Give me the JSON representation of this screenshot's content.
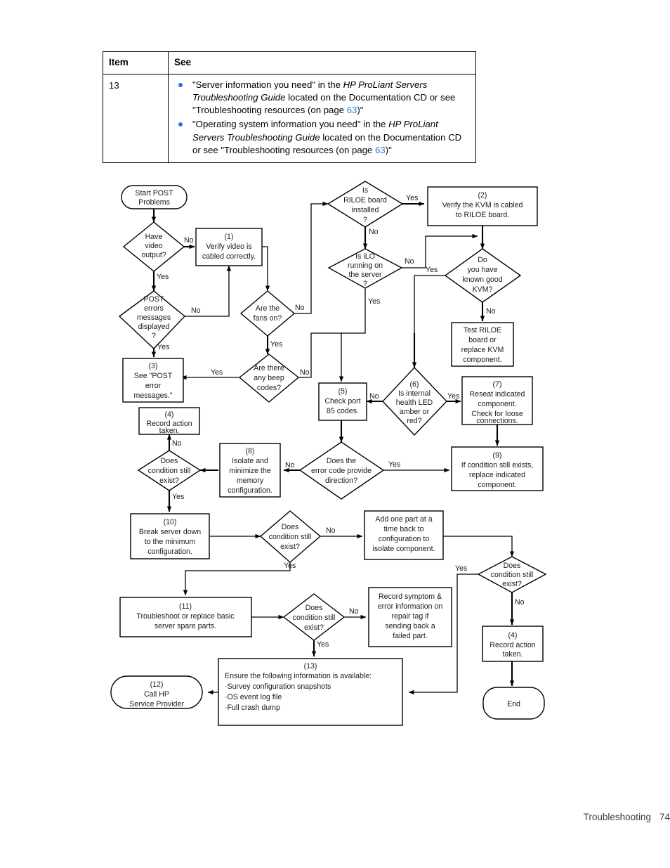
{
  "table": {
    "headers": [
      "Item",
      "See"
    ],
    "rows": [
      {
        "item": "13",
        "bullets": [
          {
            "pre": "\"Server information you need\" in the ",
            "italic": "HP ProLiant Servers Troubleshooting Guide",
            "mid": " located on the Documentation CD or see \"Troubleshooting resources (on page ",
            "link": "63",
            "post": ")\""
          },
          {
            "pre": "\"Operating system information you need\" in the ",
            "italic": "HP ProLiant Servers Troubleshooting Guide",
            "mid": " located on the Documentation CD or see \"Troubleshooting resources (on page ",
            "link": "63",
            "post": ")\""
          }
        ]
      }
    ]
  },
  "flowchart": {
    "title": "POST problems troubleshooting flowchart",
    "nodes": {
      "start": {
        "shape": "terminator",
        "lines": [
          "Start POST",
          "Problems"
        ]
      },
      "have_video": {
        "shape": "decision",
        "lines": [
          "Have",
          "video",
          "output?"
        ]
      },
      "step1": {
        "shape": "process",
        "lines": [
          "(1)",
          "Verify video is",
          "cabled correctly."
        ]
      },
      "post_errors": {
        "shape": "decision",
        "lines": [
          "POST",
          "errors",
          "messages",
          "displayed",
          "?"
        ]
      },
      "step3": {
        "shape": "process",
        "lines": [
          "(3)",
          "See \"POST",
          "error",
          "messages.\""
        ]
      },
      "fans_on": {
        "shape": "decision",
        "lines": [
          "Are the",
          "fans on?"
        ]
      },
      "beep_codes": {
        "shape": "decision",
        "lines": [
          "Are there",
          "any beep",
          "codes?"
        ]
      },
      "riloe_installed": {
        "shape": "decision",
        "lines": [
          "Is",
          "RILOE board",
          "installed",
          "?"
        ]
      },
      "step2": {
        "shape": "process",
        "lines": [
          "(2)",
          "Verify the KVM is cabled",
          "to RILOE board."
        ]
      },
      "ilo_running": {
        "shape": "decision",
        "lines": [
          "Is iLO",
          "running on",
          "the server",
          "?"
        ]
      },
      "known_good_kvm": {
        "shape": "decision",
        "lines": [
          "Do",
          "you have",
          "known good",
          "KVM?"
        ]
      },
      "test_riloe": {
        "shape": "process",
        "lines": [
          "Test RILOE",
          "board or",
          "replace KVM",
          "component."
        ]
      },
      "step5": {
        "shape": "process",
        "lines": [
          "(5)",
          "Check port",
          "85 codes."
        ]
      },
      "step6": {
        "shape": "decision",
        "lines": [
          "(6)",
          "Is internal",
          "health LED",
          "amber or",
          "red?"
        ]
      },
      "step7": {
        "shape": "process",
        "lines": [
          "(7)",
          "Reseat indicated",
          "component.",
          "Check for loose",
          "connections."
        ]
      },
      "step4a": {
        "shape": "process",
        "lines": [
          "(4)",
          "Record action",
          "taken."
        ]
      },
      "cond_still_a": {
        "shape": "decision",
        "lines": [
          "Does",
          "condition still",
          "exist?"
        ]
      },
      "step8": {
        "shape": "process",
        "lines": [
          "(8)",
          "Isolate and",
          "minimize the",
          "memory",
          "configuration."
        ]
      },
      "error_direction": {
        "shape": "decision",
        "lines": [
          "Does the",
          "error code provide",
          "direction?"
        ]
      },
      "step9": {
        "shape": "process",
        "lines": [
          "(9)",
          "If condition still exists,",
          "replace indicated",
          "component."
        ]
      },
      "step10": {
        "shape": "process",
        "lines": [
          "(10)",
          "Break server down",
          "to the minimum",
          "configuration."
        ]
      },
      "cond_still_b": {
        "shape": "decision",
        "lines": [
          "Does",
          "condition still",
          "exist?"
        ]
      },
      "add_one_part": {
        "shape": "process",
        "lines": [
          "Add one part at a",
          "time back to",
          "configuration to",
          "isolate component."
        ]
      },
      "cond_still_c": {
        "shape": "decision",
        "lines": [
          "Does",
          "condition still",
          "exist?"
        ]
      },
      "step11": {
        "shape": "process",
        "lines": [
          "(11)",
          "Troubleshoot or replace basic",
          "server spare parts."
        ]
      },
      "cond_still_d": {
        "shape": "decision",
        "lines": [
          "Does",
          "condition still",
          "exist?"
        ]
      },
      "record_symptom": {
        "shape": "process",
        "lines": [
          "Record symptom &",
          "error information on",
          "repair tag if",
          "sending back a",
          "failed part."
        ]
      },
      "step4b": {
        "shape": "process",
        "lines": [
          "(4)",
          "Record action",
          "taken."
        ]
      },
      "step13": {
        "shape": "process",
        "lines": [
          "(13)",
          "Ensure the following information is available:",
          "·Survey configuration snapshots",
          "·OS event log file",
          "·Full crash dump"
        ]
      },
      "step12": {
        "shape": "terminator",
        "lines": [
          "(12)",
          "Call HP",
          "Service Provider"
        ]
      },
      "end": {
        "shape": "terminator",
        "lines": [
          "End"
        ]
      }
    },
    "edge_labels": {
      "have_video_no": "No",
      "have_video_yes": "Yes",
      "post_errors_no": "No",
      "post_errors_yes": "Yes",
      "fans_on_no": "No",
      "fans_on_yes": "Yes",
      "beep_no": "No",
      "beep_yes": "Yes",
      "riloe_yes": "Yes",
      "riloe_no": "No",
      "ilo_no": "No",
      "ilo_yes": "Yes",
      "kvm_yes": "Yes",
      "kvm_no": "No",
      "health_no": "No",
      "health_yes": "Yes",
      "cond_a_no": "No",
      "cond_a_yes": "Yes",
      "direction_no": "No",
      "direction_yes": "Yes",
      "cond_b_no": "No",
      "cond_b_yes": "Yes",
      "cond_c_yes": "Yes",
      "cond_c_no": "No",
      "cond_d_no": "No",
      "cond_d_yes": "Yes"
    }
  },
  "footer": {
    "section": "Troubleshooting",
    "page": "74"
  },
  "colors": {
    "link": "#2a7fd4",
    "bullet": "#1a7ae0",
    "stroke": "#000000",
    "footer_text": "#3c3c3c"
  }
}
